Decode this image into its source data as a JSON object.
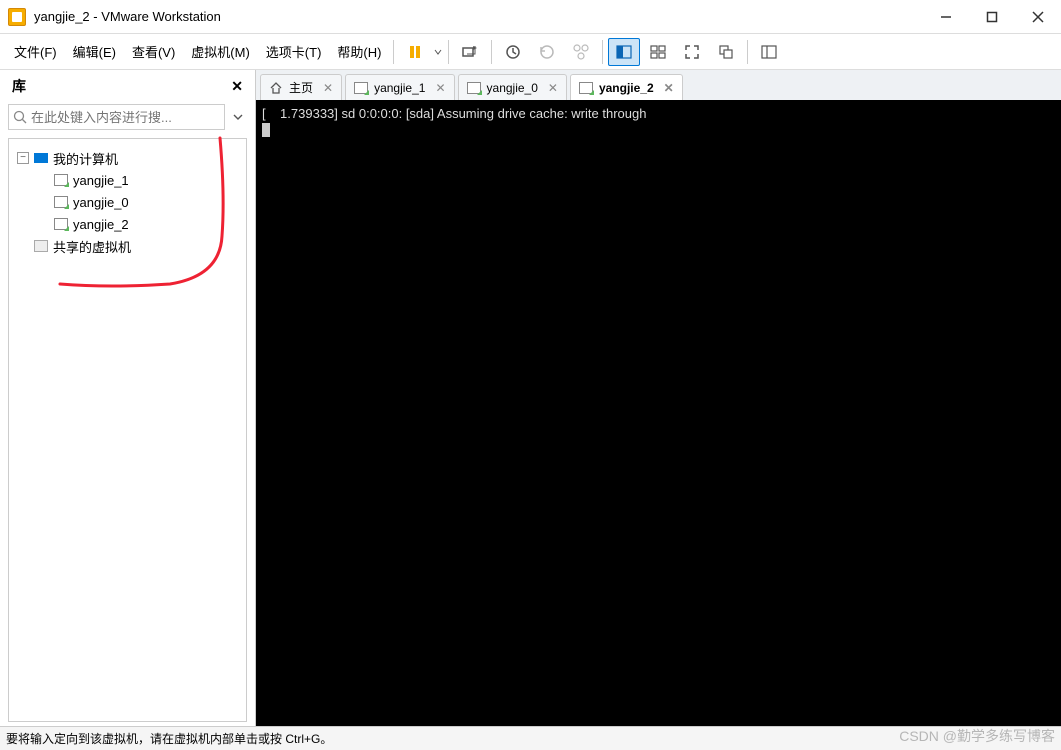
{
  "window": {
    "title": "yangjie_2 - VMware Workstation"
  },
  "menu": {
    "items": [
      "文件(F)",
      "编辑(E)",
      "查看(V)",
      "虚拟机(M)",
      "选项卡(T)",
      "帮助(H)"
    ]
  },
  "library": {
    "title": "库",
    "search_placeholder": "在此处键入内容进行搜...",
    "root": {
      "label": "我的计算机",
      "expanded": true,
      "children": [
        {
          "label": "yangjie_1"
        },
        {
          "label": "yangjie_0"
        },
        {
          "label": "yangjie_2"
        }
      ]
    },
    "shared": {
      "label": "共享的虚拟机"
    }
  },
  "tabs": [
    {
      "label": "主页",
      "type": "home",
      "active": false,
      "closable": true
    },
    {
      "label": "yangjie_1",
      "type": "vm",
      "active": false,
      "closable": true
    },
    {
      "label": "yangjie_0",
      "type": "vm",
      "active": false,
      "closable": true
    },
    {
      "label": "yangjie_2",
      "type": "vm",
      "active": true,
      "closable": true
    }
  ],
  "terminal": {
    "line": "[    1.739333] sd 0:0:0:0: [sda] Assuming drive cache: write through"
  },
  "status": {
    "message": "要将输入定向到该虚拟机，请在虚拟机内部单击或按 Ctrl+G。"
  },
  "watermark": "CSDN @勤学多练写博客"
}
